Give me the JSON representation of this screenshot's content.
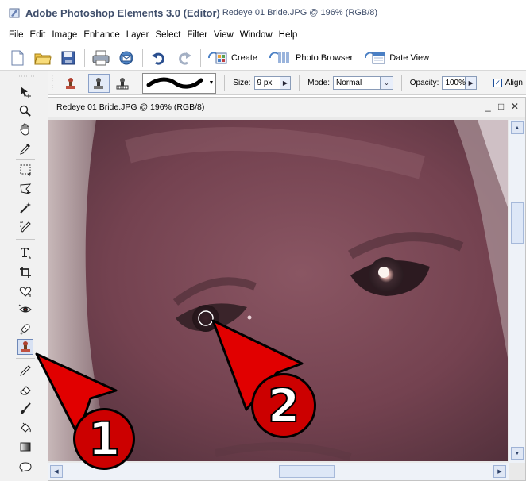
{
  "window": {
    "app_title": "Adobe Photoshop Elements 3.0 (Editor)",
    "doc_title": "Redeye 01 Bride.JPG @ 196% (RGB/8)"
  },
  "menu": [
    "File",
    "Edit",
    "Image",
    "Enhance",
    "Layer",
    "Select",
    "Filter",
    "View",
    "Window",
    "Help"
  ],
  "shortcuts": {
    "create": "Create",
    "photo_browser": "Photo Browser",
    "date_view": "Date View"
  },
  "options": {
    "size_label": "Size:",
    "size_value": "9 px",
    "mode_label": "Mode:",
    "mode_value": "Normal",
    "opacity_label": "Opacity:",
    "opacity_value": "100%",
    "align_label": "Align"
  },
  "document": {
    "title": "Redeye 01 Bride.JPG @ 196% (RGB/8)",
    "minimize": "_",
    "restore": "□",
    "close": "✕"
  },
  "annotations": {
    "callout_1": "1",
    "callout_2": "2"
  },
  "colors": {
    "arrow_red": "#e10000",
    "badge_red": "#cc0000",
    "title_text": "#3f4e6b"
  },
  "icons": [
    "new-file-icon",
    "open-folder-icon",
    "save-icon",
    "print-icon",
    "email-icon",
    "undo-icon",
    "redo-icon",
    "clone-stamp-icon",
    "pattern-stamp-icon",
    "move-tool-icon",
    "zoom-tool-icon",
    "hand-tool-icon",
    "eyedropper-icon",
    "marquee-icon",
    "lasso-icon",
    "magic-wand-icon",
    "selection-brush-icon",
    "type-tool-icon",
    "crop-tool-icon",
    "cookie-cutter-icon",
    "red-eye-icon",
    "spot-healing-icon",
    "stamp-tool-icon",
    "pencil-icon",
    "eraser-icon",
    "brush-icon",
    "paint-bucket-icon",
    "gradient-icon",
    "shape-icon"
  ]
}
